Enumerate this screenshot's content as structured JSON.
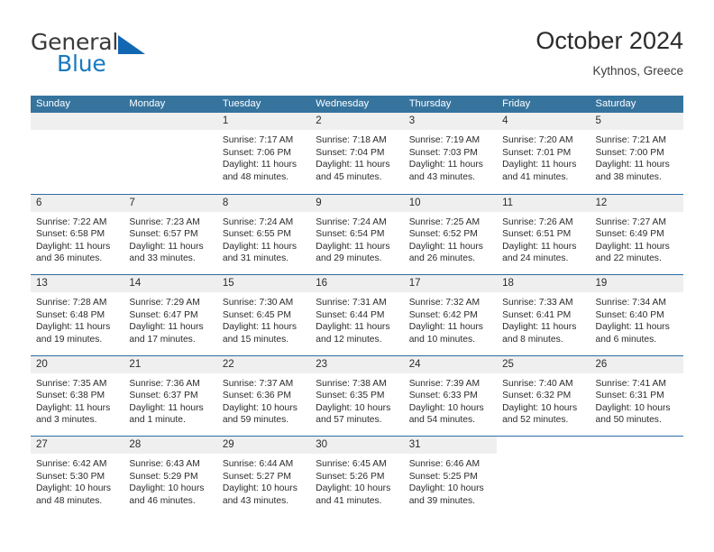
{
  "logo": {
    "text_top": "General",
    "text_bottom": "Blue",
    "triangle_icon": "triangle-icon",
    "color_top": "#3a3a3a",
    "color_bottom": "#1879bf",
    "color_triangle": "#1267b2"
  },
  "header": {
    "title": "October 2024",
    "subtitle": "Kythnos, Greece"
  },
  "theme": {
    "header_bar": "#36749e",
    "row_divider": "#2e6da4",
    "day_band": "#efefef",
    "text": "#2b2b2b"
  },
  "weekdays": [
    "Sunday",
    "Monday",
    "Tuesday",
    "Wednesday",
    "Thursday",
    "Friday",
    "Saturday"
  ],
  "weeks": [
    [
      {
        "day": "",
        "lines": []
      },
      {
        "day": "",
        "lines": []
      },
      {
        "day": "1",
        "lines": [
          "Sunrise: 7:17 AM",
          "Sunset: 7:06 PM",
          "Daylight: 11 hours",
          "and 48 minutes."
        ]
      },
      {
        "day": "2",
        "lines": [
          "Sunrise: 7:18 AM",
          "Sunset: 7:04 PM",
          "Daylight: 11 hours",
          "and 45 minutes."
        ]
      },
      {
        "day": "3",
        "lines": [
          "Sunrise: 7:19 AM",
          "Sunset: 7:03 PM",
          "Daylight: 11 hours",
          "and 43 minutes."
        ]
      },
      {
        "day": "4",
        "lines": [
          "Sunrise: 7:20 AM",
          "Sunset: 7:01 PM",
          "Daylight: 11 hours",
          "and 41 minutes."
        ]
      },
      {
        "day": "5",
        "lines": [
          "Sunrise: 7:21 AM",
          "Sunset: 7:00 PM",
          "Daylight: 11 hours",
          "and 38 minutes."
        ]
      }
    ],
    [
      {
        "day": "6",
        "lines": [
          "Sunrise: 7:22 AM",
          "Sunset: 6:58 PM",
          "Daylight: 11 hours",
          "and 36 minutes."
        ]
      },
      {
        "day": "7",
        "lines": [
          "Sunrise: 7:23 AM",
          "Sunset: 6:57 PM",
          "Daylight: 11 hours",
          "and 33 minutes."
        ]
      },
      {
        "day": "8",
        "lines": [
          "Sunrise: 7:24 AM",
          "Sunset: 6:55 PM",
          "Daylight: 11 hours",
          "and 31 minutes."
        ]
      },
      {
        "day": "9",
        "lines": [
          "Sunrise: 7:24 AM",
          "Sunset: 6:54 PM",
          "Daylight: 11 hours",
          "and 29 minutes."
        ]
      },
      {
        "day": "10",
        "lines": [
          "Sunrise: 7:25 AM",
          "Sunset: 6:52 PM",
          "Daylight: 11 hours",
          "and 26 minutes."
        ]
      },
      {
        "day": "11",
        "lines": [
          "Sunrise: 7:26 AM",
          "Sunset: 6:51 PM",
          "Daylight: 11 hours",
          "and 24 minutes."
        ]
      },
      {
        "day": "12",
        "lines": [
          "Sunrise: 7:27 AM",
          "Sunset: 6:49 PM",
          "Daylight: 11 hours",
          "and 22 minutes."
        ]
      }
    ],
    [
      {
        "day": "13",
        "lines": [
          "Sunrise: 7:28 AM",
          "Sunset: 6:48 PM",
          "Daylight: 11 hours",
          "and 19 minutes."
        ]
      },
      {
        "day": "14",
        "lines": [
          "Sunrise: 7:29 AM",
          "Sunset: 6:47 PM",
          "Daylight: 11 hours",
          "and 17 minutes."
        ]
      },
      {
        "day": "15",
        "lines": [
          "Sunrise: 7:30 AM",
          "Sunset: 6:45 PM",
          "Daylight: 11 hours",
          "and 15 minutes."
        ]
      },
      {
        "day": "16",
        "lines": [
          "Sunrise: 7:31 AM",
          "Sunset: 6:44 PM",
          "Daylight: 11 hours",
          "and 12 minutes."
        ]
      },
      {
        "day": "17",
        "lines": [
          "Sunrise: 7:32 AM",
          "Sunset: 6:42 PM",
          "Daylight: 11 hours",
          "and 10 minutes."
        ]
      },
      {
        "day": "18",
        "lines": [
          "Sunrise: 7:33 AM",
          "Sunset: 6:41 PM",
          "Daylight: 11 hours",
          "and 8 minutes."
        ]
      },
      {
        "day": "19",
        "lines": [
          "Sunrise: 7:34 AM",
          "Sunset: 6:40 PM",
          "Daylight: 11 hours",
          "and 6 minutes."
        ]
      }
    ],
    [
      {
        "day": "20",
        "lines": [
          "Sunrise: 7:35 AM",
          "Sunset: 6:38 PM",
          "Daylight: 11 hours",
          "and 3 minutes."
        ]
      },
      {
        "day": "21",
        "lines": [
          "Sunrise: 7:36 AM",
          "Sunset: 6:37 PM",
          "Daylight: 11 hours",
          "and 1 minute."
        ]
      },
      {
        "day": "22",
        "lines": [
          "Sunrise: 7:37 AM",
          "Sunset: 6:36 PM",
          "Daylight: 10 hours",
          "and 59 minutes."
        ]
      },
      {
        "day": "23",
        "lines": [
          "Sunrise: 7:38 AM",
          "Sunset: 6:35 PM",
          "Daylight: 10 hours",
          "and 57 minutes."
        ]
      },
      {
        "day": "24",
        "lines": [
          "Sunrise: 7:39 AM",
          "Sunset: 6:33 PM",
          "Daylight: 10 hours",
          "and 54 minutes."
        ]
      },
      {
        "day": "25",
        "lines": [
          "Sunrise: 7:40 AM",
          "Sunset: 6:32 PM",
          "Daylight: 10 hours",
          "and 52 minutes."
        ]
      },
      {
        "day": "26",
        "lines": [
          "Sunrise: 7:41 AM",
          "Sunset: 6:31 PM",
          "Daylight: 10 hours",
          "and 50 minutes."
        ]
      }
    ],
    [
      {
        "day": "27",
        "lines": [
          "Sunrise: 6:42 AM",
          "Sunset: 5:30 PM",
          "Daylight: 10 hours",
          "and 48 minutes."
        ]
      },
      {
        "day": "28",
        "lines": [
          "Sunrise: 6:43 AM",
          "Sunset: 5:29 PM",
          "Daylight: 10 hours",
          "and 46 minutes."
        ]
      },
      {
        "day": "29",
        "lines": [
          "Sunrise: 6:44 AM",
          "Sunset: 5:27 PM",
          "Daylight: 10 hours",
          "and 43 minutes."
        ]
      },
      {
        "day": "30",
        "lines": [
          "Sunrise: 6:45 AM",
          "Sunset: 5:26 PM",
          "Daylight: 10 hours",
          "and 41 minutes."
        ]
      },
      {
        "day": "31",
        "lines": [
          "Sunrise: 6:46 AM",
          "Sunset: 5:25 PM",
          "Daylight: 10 hours",
          "and 39 minutes."
        ]
      },
      {
        "day": "",
        "lines": []
      },
      {
        "day": "",
        "lines": []
      }
    ]
  ]
}
